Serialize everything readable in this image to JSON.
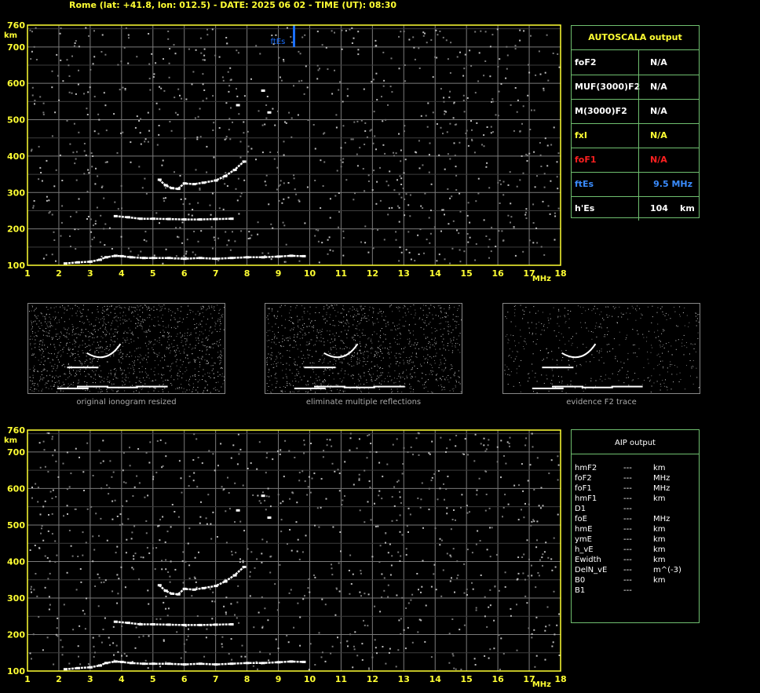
{
  "header": {
    "title": "Rome (lat: +41.8, lon: 012.5) - DATE: 2025 06 02 - TIME (UT): 08:30"
  },
  "chart_data": [
    {
      "type": "scatter",
      "title": "",
      "xlabel": "MHz",
      "ylabel": "km",
      "xlim": [
        1,
        18
      ],
      "ylim": [
        100,
        760
      ],
      "x_ticks": [
        "1",
        "2",
        "3",
        "4",
        "5",
        "6",
        "7",
        "8",
        "9",
        "10",
        "11",
        "12",
        "13",
        "14",
        "15",
        "16",
        "17",
        "18"
      ],
      "y_ticks": [
        "100",
        "200",
        "300",
        "400",
        "500",
        "600",
        "700",
        "760"
      ],
      "grid": true,
      "annotation": {
        "label": "ftEs",
        "x": 9.5
      },
      "series": [
        {
          "name": "",
          "x": [
            2.2,
            2.6,
            3.0,
            3.3,
            3.5,
            3.8,
            4.0,
            4.3,
            4.7,
            5.0,
            5.5,
            6.0,
            6.5,
            7.0,
            7.5,
            8.0,
            8.5,
            9.0,
            9.4,
            9.8
          ],
          "y": [
            105,
            108,
            110,
            115,
            122,
            126,
            125,
            122,
            120,
            120,
            120,
            118,
            120,
            118,
            120,
            122,
            122,
            124,
            126,
            125
          ]
        },
        {
          "name": "",
          "x": [
            3.8,
            4.2,
            4.6,
            5.0,
            5.5,
            6.0,
            6.5,
            7.0,
            7.5
          ],
          "y": [
            235,
            232,
            228,
            228,
            227,
            226,
            226,
            227,
            228
          ]
        },
        {
          "name": "",
          "x": [
            5.2,
            5.4,
            5.6,
            5.8,
            6.0,
            6.3,
            6.6,
            7.0,
            7.3,
            7.6,
            7.9
          ],
          "y": [
            335,
            320,
            312,
            310,
            325,
            323,
            327,
            333,
            345,
            362,
            385
          ]
        },
        {
          "name": "",
          "x": [
            7.7,
            8.5,
            8.7
          ],
          "y": [
            540,
            580,
            520
          ]
        }
      ]
    },
    {
      "type": "scatter",
      "title": "",
      "xlabel": "MHz",
      "ylabel": "km",
      "xlim": [
        1,
        18
      ],
      "ylim": [
        100,
        760
      ],
      "x_ticks": [
        "1",
        "2",
        "3",
        "4",
        "5",
        "6",
        "7",
        "8",
        "9",
        "10",
        "11",
        "12",
        "13",
        "14",
        "15",
        "16",
        "17",
        "18"
      ],
      "y_ticks": [
        "100",
        "200",
        "300",
        "400",
        "500",
        "600",
        "700",
        "760"
      ],
      "grid": true,
      "series": [
        {
          "name": "",
          "x": [
            2.2,
            2.6,
            3.0,
            3.3,
            3.5,
            3.8,
            4.0,
            4.3,
            4.7,
            5.0,
            5.5,
            6.0,
            6.5,
            7.0,
            7.5,
            8.0,
            8.5,
            9.0,
            9.4,
            9.8
          ],
          "y": [
            105,
            108,
            110,
            115,
            122,
            126,
            125,
            122,
            120,
            120,
            120,
            118,
            120,
            118,
            120,
            122,
            122,
            124,
            126,
            125
          ]
        },
        {
          "name": "",
          "x": [
            3.8,
            4.2,
            4.6,
            5.0,
            5.5,
            6.0,
            6.5,
            7.0,
            7.5
          ],
          "y": [
            235,
            232,
            228,
            228,
            227,
            226,
            226,
            227,
            228
          ]
        },
        {
          "name": "",
          "x": [
            5.2,
            5.4,
            5.6,
            5.8,
            6.0,
            6.3,
            6.6,
            7.0,
            7.3,
            7.6,
            7.9
          ],
          "y": [
            335,
            320,
            312,
            310,
            325,
            323,
            327,
            333,
            345,
            362,
            385
          ]
        },
        {
          "name": "",
          "x": [
            7.7,
            8.5,
            8.7
          ],
          "y": [
            540,
            580,
            520
          ]
        }
      ]
    }
  ],
  "autoscala": {
    "title": "AUTOSCALA output",
    "rows": [
      {
        "key": "foF2",
        "value": "N/A",
        "unit": "",
        "color": "#ffffff"
      },
      {
        "key": "MUF(3000)F2",
        "value": "N/A",
        "unit": "",
        "color": "#ffffff"
      },
      {
        "key": "M(3000)F2",
        "value": "N/A",
        "unit": "",
        "color": "#ffffff"
      },
      {
        "key": "fxI",
        "value": "N/A",
        "unit": "",
        "color": "#ffff33"
      },
      {
        "key": "foF1",
        "value": "N/A",
        "unit": "",
        "color": "#ff2020"
      },
      {
        "key": "ftEs",
        "value": "9.5 MHz",
        "unit": "",
        "color": "#3a8cff"
      },
      {
        "key": "h'Es",
        "value": "104",
        "unit": "km",
        "color": "#ffffff"
      }
    ]
  },
  "thumbnails": [
    {
      "caption": "original ionogram resized"
    },
    {
      "caption": "eliminate multiple reflections"
    },
    {
      "caption": "evidence F2 trace"
    }
  ],
  "aip": {
    "title": "AIP output",
    "rows": [
      {
        "key": "hmF2",
        "value": "---",
        "unit": "km"
      },
      {
        "key": "foF2",
        "value": "---",
        "unit": "MHz"
      },
      {
        "key": "foF1",
        "value": "---",
        "unit": "MHz"
      },
      {
        "key": "hmF1",
        "value": "---",
        "unit": "km"
      },
      {
        "key": "D1",
        "value": "---",
        "unit": ""
      },
      {
        "key": "foE",
        "value": "---",
        "unit": "MHz"
      },
      {
        "key": "hmE",
        "value": "---",
        "unit": "km"
      },
      {
        "key": "ymE",
        "value": "---",
        "unit": "km"
      },
      {
        "key": "h_vE",
        "value": "---",
        "unit": "km"
      },
      {
        "key": "Ewidth",
        "value": "---",
        "unit": "km"
      },
      {
        "key": "DelN_vE",
        "value": "---",
        "unit": "m^(-3)"
      },
      {
        "key": "B0",
        "value": "---",
        "unit": "km"
      },
      {
        "key": "B1",
        "value": "---",
        "unit": ""
      }
    ]
  },
  "colors": {
    "axis": "#ffff33",
    "grid": "#7a7a7a",
    "table_border": "#6fbf6f",
    "es_marker": "#1a6fff"
  }
}
